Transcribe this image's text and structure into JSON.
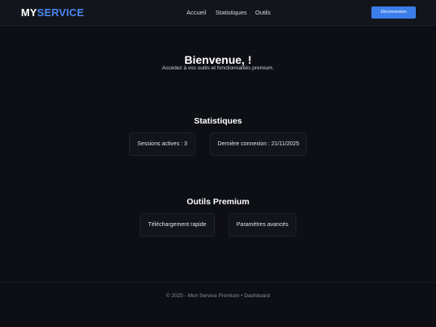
{
  "header": {
    "logo_my": "MY",
    "logo_service": "SERVICE",
    "nav": {
      "home": "Accueil",
      "stats": "Statistiques",
      "tools": "Outils"
    },
    "logout_label": "Déconnexion"
  },
  "welcome": {
    "title": "Bienvenue, !",
    "subtitle": "Accédez à vos outils et fonctionnalités premium."
  },
  "stats": {
    "title": "Statistiques",
    "sessions": "Sessions actives : 3",
    "last_login": "Dernière connexion : 21/11/2025"
  },
  "tools": {
    "title": "Outils Premium",
    "download": "Téléchargement rapide",
    "settings": "Paramètres avancés"
  },
  "footer": {
    "text": "© 2025 - Mon Service Premium • Dashboard"
  },
  "colors": {
    "background": "#0d0f14",
    "accent": "#3b7de9",
    "logo_accent": "#4a86f0"
  }
}
